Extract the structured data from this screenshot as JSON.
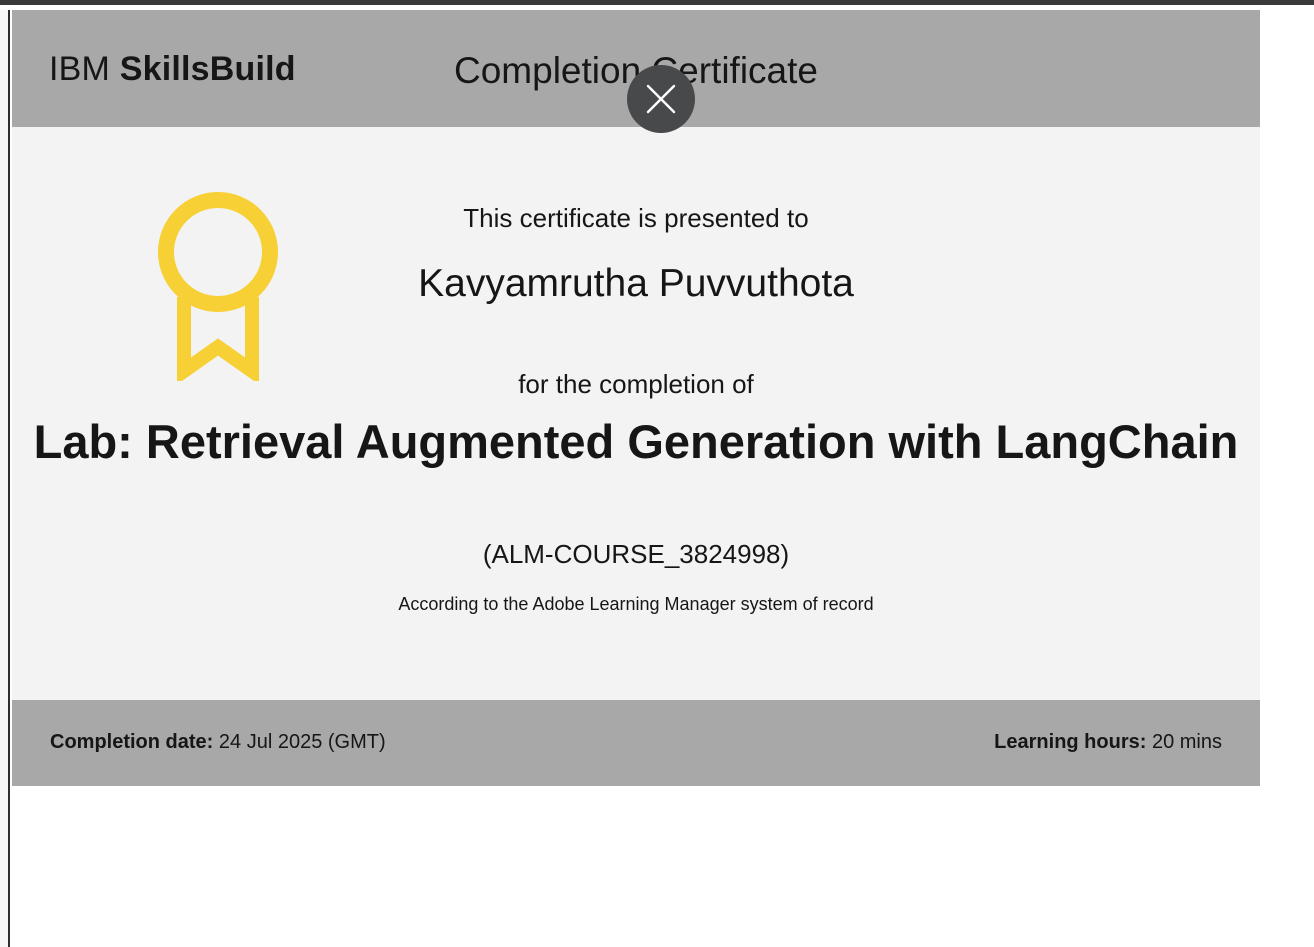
{
  "header": {
    "brand_prefix": "IBM",
    "brand_name": "SkillsBuild",
    "title": "Completion Certificate"
  },
  "close_button": {
    "icon": "close-icon"
  },
  "badge": {
    "icon": "award-ribbon-icon",
    "color": "#f7d035"
  },
  "certificate": {
    "presented_to": "This certificate is presented to",
    "recipient": "Kavyamrutha Puvvuthota",
    "for_completion": "for the completion of",
    "course_title": "Lab: Retrieval Augmented Generation with LangChain",
    "course_code": "(ALM-COURSE_3824998)",
    "record_note": "According to the Adobe Learning Manager system of record"
  },
  "footer": {
    "completion_label": "Completion date:",
    "completion_value": "24 Jul 2025 (GMT)",
    "hours_label": "Learning hours:",
    "hours_value": "20 mins"
  },
  "colors": {
    "header_bg": "#a8a8a8",
    "body_bg": "#f3f3f3",
    "close_bg": "#48494b"
  }
}
